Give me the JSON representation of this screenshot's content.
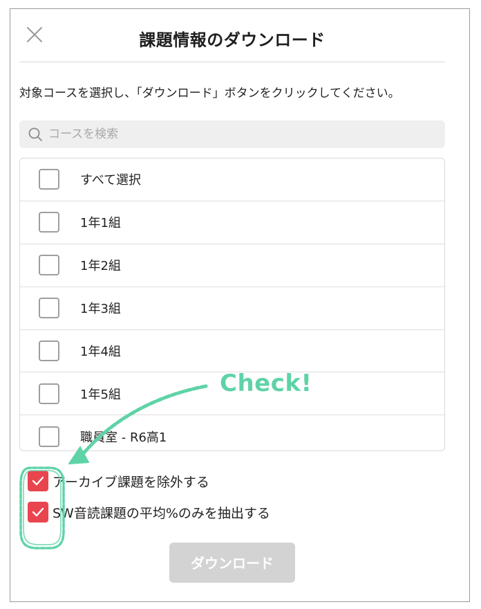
{
  "header": {
    "title": "課題情報のダウンロード",
    "close_icon": "close-icon"
  },
  "instruction": "対象コースを選択し、「ダウンロード」ボタンをクリックしてください。",
  "search": {
    "placeholder": "コースを検索",
    "value": "",
    "icon": "search-icon"
  },
  "course_list": {
    "select_all_label": "すべて選択",
    "items": [
      {
        "label": "1年1組",
        "checked": false
      },
      {
        "label": "1年2組",
        "checked": false
      },
      {
        "label": "1年3組",
        "checked": false
      },
      {
        "label": "1年4組",
        "checked": false
      },
      {
        "label": "1年5組",
        "checked": false
      },
      {
        "label": "職員室 - R6高1",
        "checked": false
      }
    ]
  },
  "options": {
    "exclude_archived": {
      "label": "アーカイブ課題を除外する",
      "checked": true
    },
    "sw_average_only": {
      "label": "SW音読課題の平均%のみを抽出する",
      "checked": true
    }
  },
  "download_button": {
    "label": "ダウンロード",
    "enabled": false
  },
  "annotation": {
    "text": "Check!",
    "color": "#5fd3a7"
  },
  "colors": {
    "checked": "#e8454f",
    "disabled_button": "#d3d3d3",
    "annotation": "#5fd3a7"
  }
}
